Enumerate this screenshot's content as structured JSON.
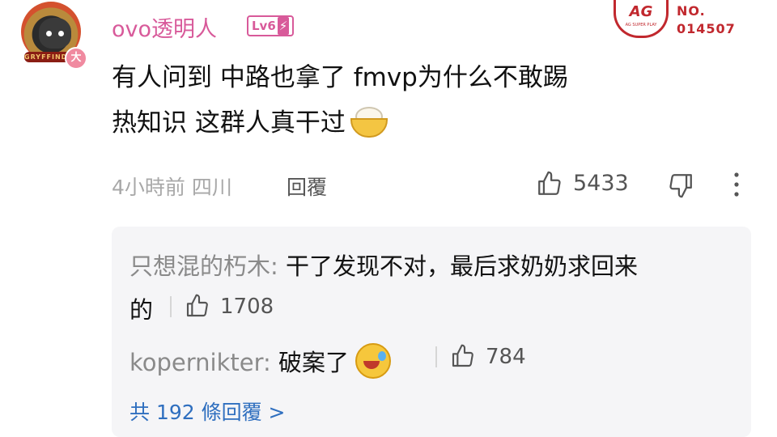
{
  "author": {
    "name": "ovo透明人",
    "level": "Lv6",
    "avatar_band_text": "GRYFFINDOR",
    "avatar_badge": "大"
  },
  "medal": {
    "logo_text": "AG",
    "logo_subtext": "AG SUPER PLAY",
    "no_label": "NO.",
    "no_value": "014507"
  },
  "comment": {
    "line1": "有人问到 中路也拿了 fmvp为什么不敢踢",
    "line2": "热知识 这群人真干过",
    "emoji": "bowl-emoji",
    "meta": "4小時前 四川",
    "reply_label": "回覆",
    "likes": "5433"
  },
  "replies": [
    {
      "author": "只想混的朽木: ",
      "text_line1": "干了发现不对，最后求奶奶求回来",
      "text_line2": "的",
      "likes": "1708"
    },
    {
      "author": "kopernikter: ",
      "text": "破案了",
      "emoji": "laugh-emoji",
      "likes": "784"
    }
  ],
  "total_replies": "共 192 條回覆 >",
  "colors": {
    "username": "#d85a9a",
    "link": "#2f6fbf",
    "medal": "#c1282e"
  }
}
